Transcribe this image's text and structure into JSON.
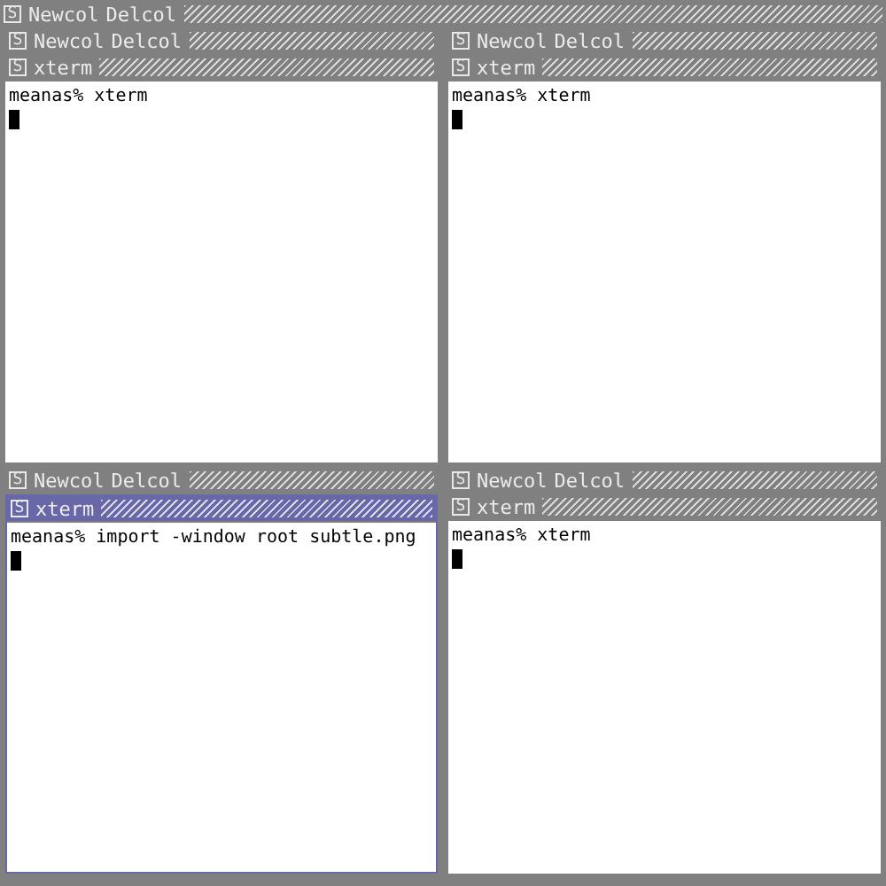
{
  "top_bar": {
    "menu": "S",
    "buttons": [
      "Newcol",
      "Delcol"
    ]
  },
  "panes": [
    {
      "column_bar": {
        "menu": "S",
        "buttons": [
          "Newcol",
          "Delcol"
        ]
      },
      "window": {
        "menu": "S",
        "title": "xterm",
        "focused": false,
        "lines": [
          "meanas% xterm"
        ]
      }
    },
    {
      "column_bar": {
        "menu": "S",
        "buttons": [
          "Newcol",
          "Delcol"
        ]
      },
      "window": {
        "menu": "S",
        "title": "xterm",
        "focused": false,
        "lines": [
          "meanas% xterm"
        ]
      }
    },
    {
      "column_bar": {
        "menu": "S",
        "buttons": [
          "Newcol",
          "Delcol"
        ]
      },
      "window": {
        "menu": "S",
        "title": "xterm",
        "focused": true,
        "lines": [
          "meanas% import -window root subtle.png"
        ]
      }
    },
    {
      "column_bar": {
        "menu": "S",
        "buttons": [
          "Newcol",
          "Delcol"
        ]
      },
      "window": {
        "menu": "S",
        "title": "xterm",
        "focused": false,
        "lines": [
          "meanas% xterm"
        ]
      }
    }
  ]
}
